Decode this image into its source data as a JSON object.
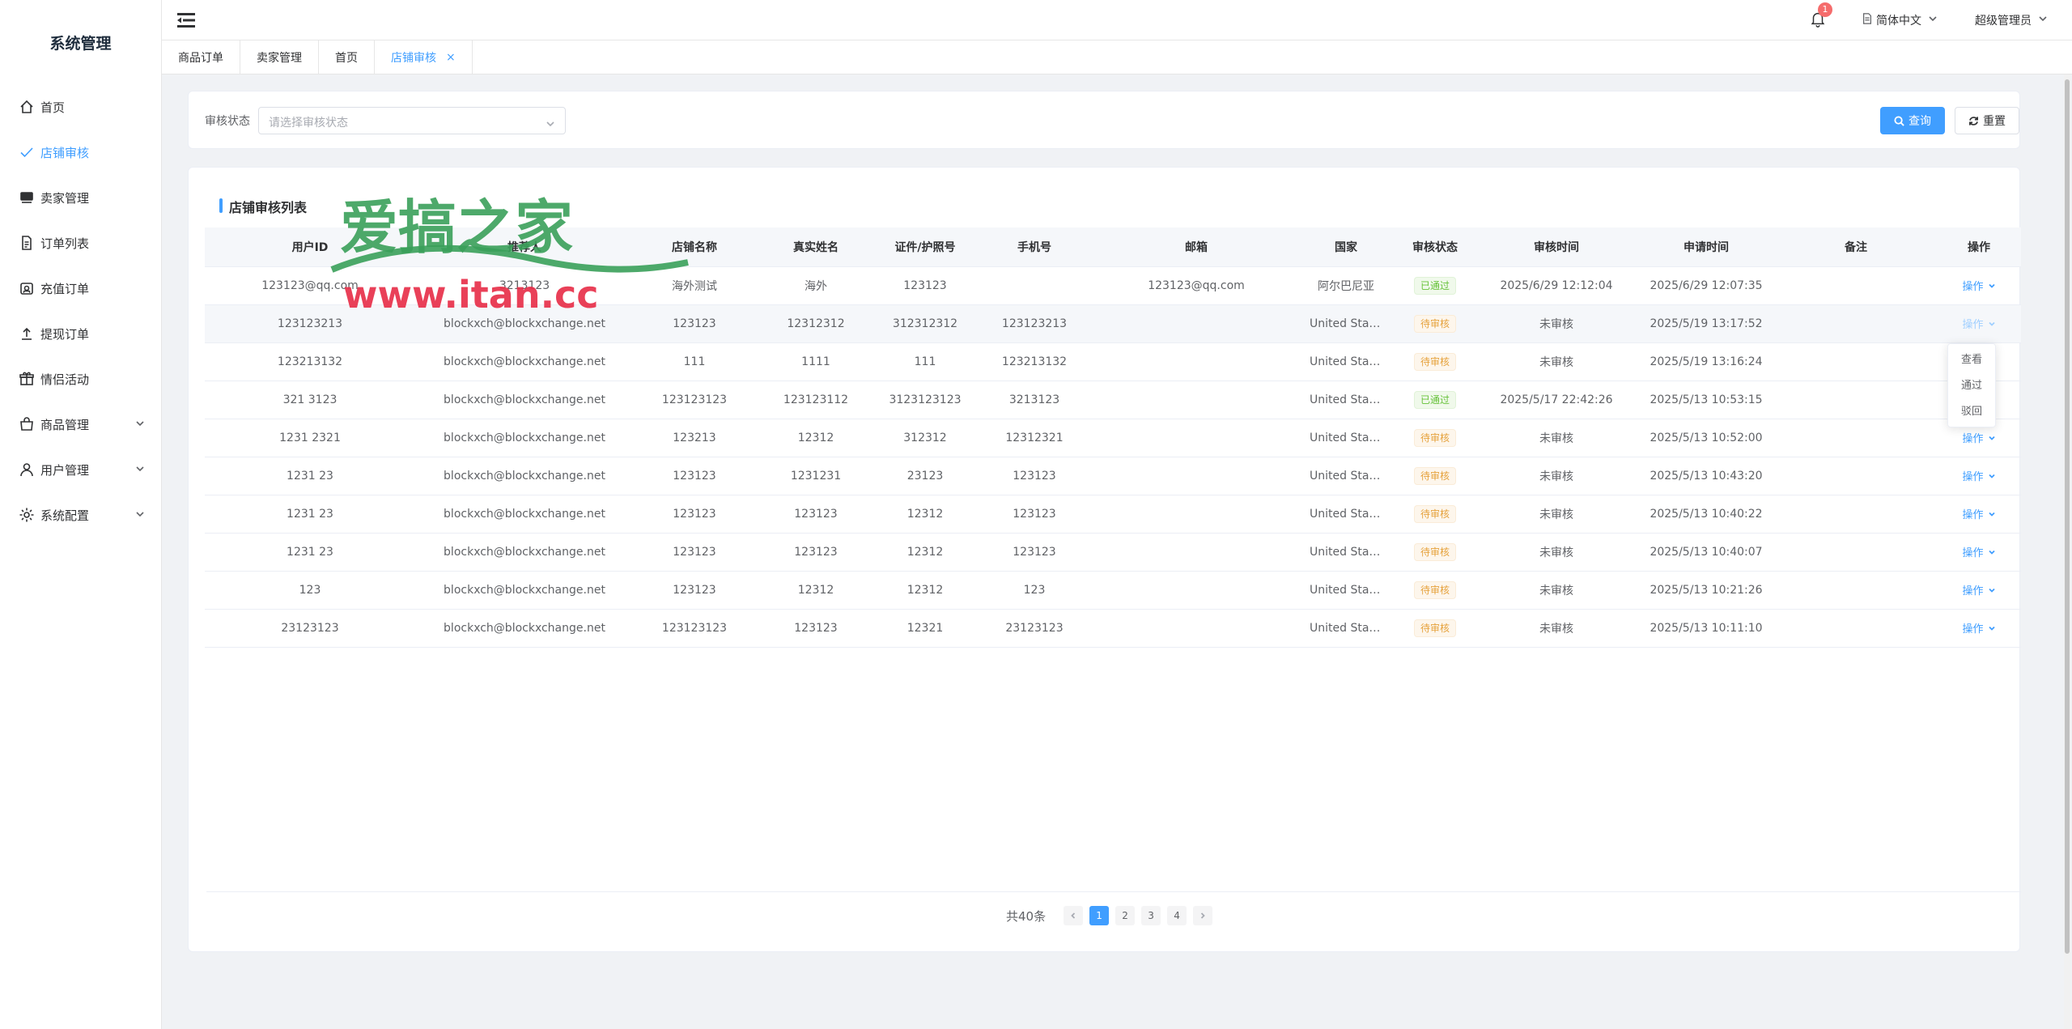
{
  "sidebar": {
    "brand": "系统管理",
    "items": [
      {
        "label": "首页",
        "icon": "home-icon"
      },
      {
        "label": "店铺审核",
        "icon": "check-icon",
        "active": true
      },
      {
        "label": "卖家管理",
        "icon": "store-icon"
      },
      {
        "label": "订单列表",
        "icon": "document-icon"
      },
      {
        "label": "充值订单",
        "icon": "wallet-icon"
      },
      {
        "label": "提现订单",
        "icon": "upload-icon"
      },
      {
        "label": "情侣活动",
        "icon": "gift-icon"
      },
      {
        "label": "商品管理",
        "icon": "bag-icon",
        "expandable": true
      },
      {
        "label": "用户管理",
        "icon": "user-icon",
        "expandable": true
      },
      {
        "label": "系统配置",
        "icon": "gear-icon",
        "expandable": true
      }
    ]
  },
  "header": {
    "notification_count": "1",
    "language": "简体中文",
    "user": "超级管理员"
  },
  "tabs": [
    {
      "label": "商品订单"
    },
    {
      "label": "卖家管理"
    },
    {
      "label": "首页"
    },
    {
      "label": "店铺审核",
      "active": true,
      "close": "×"
    }
  ],
  "filter": {
    "label": "审核状态",
    "placeholder": "请选择审核状态",
    "search_label": "查询",
    "reset_label": "重置"
  },
  "table": {
    "title": "店铺审核列表",
    "columns": [
      "用户ID",
      "推荐人",
      "店铺名称",
      "真实姓名",
      "证件/护照号",
      "手机号",
      "邮箱",
      "国家",
      "审核状态",
      "审核时间",
      "申请时间",
      "备注",
      "操作"
    ],
    "rows": [
      [
        "123123@qq.com",
        "3213123",
        "海外测试",
        "海外",
        "123123",
        "",
        "123123@qq.com",
        "阿尔巴尼亚",
        "已通过",
        "2025/6/29 12:12:04",
        "2025/6/29 12:07:35",
        "",
        "操作"
      ],
      [
        "123123213",
        "blockxch@blockxchange.net",
        "123123",
        "12312312",
        "312312312",
        "123123213",
        "",
        "United States",
        "待审核",
        "未审核",
        "2025/5/19 13:17:52",
        "",
        "操作"
      ],
      [
        "123213132",
        "blockxch@blockxchange.net",
        "111",
        "1111",
        "111",
        "123213132",
        "",
        "United States",
        "待审核",
        "未审核",
        "2025/5/19 13:16:24",
        "",
        "操作"
      ],
      [
        "321 3123",
        "blockxch@blockxchange.net",
        "123123123",
        "123123112",
        "3123123123",
        "3213123",
        "",
        "United States",
        "已通过",
        "2025/5/17 22:42:26",
        "2025/5/13 10:53:15",
        "",
        "操作"
      ],
      [
        "1231 2321",
        "blockxch@blockxchange.net",
        "123213",
        "12312",
        "312312",
        "12312321",
        "",
        "United States",
        "待审核",
        "未审核",
        "2025/5/13 10:52:00",
        "",
        "操作"
      ],
      [
        "1231 23",
        "blockxch@blockxchange.net",
        "123123",
        "1231231",
        "23123",
        "123123",
        "",
        "United States",
        "待审核",
        "未审核",
        "2025/5/13 10:43:20",
        "",
        "操作"
      ],
      [
        "1231 23",
        "blockxch@blockxchange.net",
        "123123",
        "123123",
        "12312",
        "123123",
        "",
        "United States",
        "待审核",
        "未审核",
        "2025/5/13 10:40:22",
        "",
        "操作"
      ],
      [
        "1231 23",
        "blockxch@blockxchange.net",
        "123123",
        "123123",
        "12312",
        "123123",
        "",
        "United States",
        "待审核",
        "未审核",
        "2025/5/13 10:40:07",
        "",
        "操作"
      ],
      [
        "123",
        "blockxch@blockxchange.net",
        "123123",
        "12312",
        "12312",
        "123",
        "",
        "United States",
        "待审核",
        "未审核",
        "2025/5/13 10:21:26",
        "",
        "操作"
      ],
      [
        "23123123",
        "blockxch@blockxchange.net",
        "123123123",
        "123123",
        "12321",
        "23123123",
        "",
        "United States",
        "待审核",
        "未审核",
        "2025/5/13 10:11:10",
        "",
        "操作"
      ]
    ]
  },
  "dropdown": {
    "items": [
      "查看",
      "通过",
      "驳回"
    ]
  },
  "pagination": {
    "total": "共40条",
    "pages": [
      "1",
      "2",
      "3",
      "4"
    ],
    "current": "1"
  },
  "watermark": {
    "title": "爱搞之家",
    "url": "www.itan.cc"
  },
  "colors": {
    "primary": "#409eff",
    "success": "#67c23a",
    "warning": "#e6a23c",
    "watermark_green": "#3aa05a",
    "watermark_red": "#e8304a"
  }
}
